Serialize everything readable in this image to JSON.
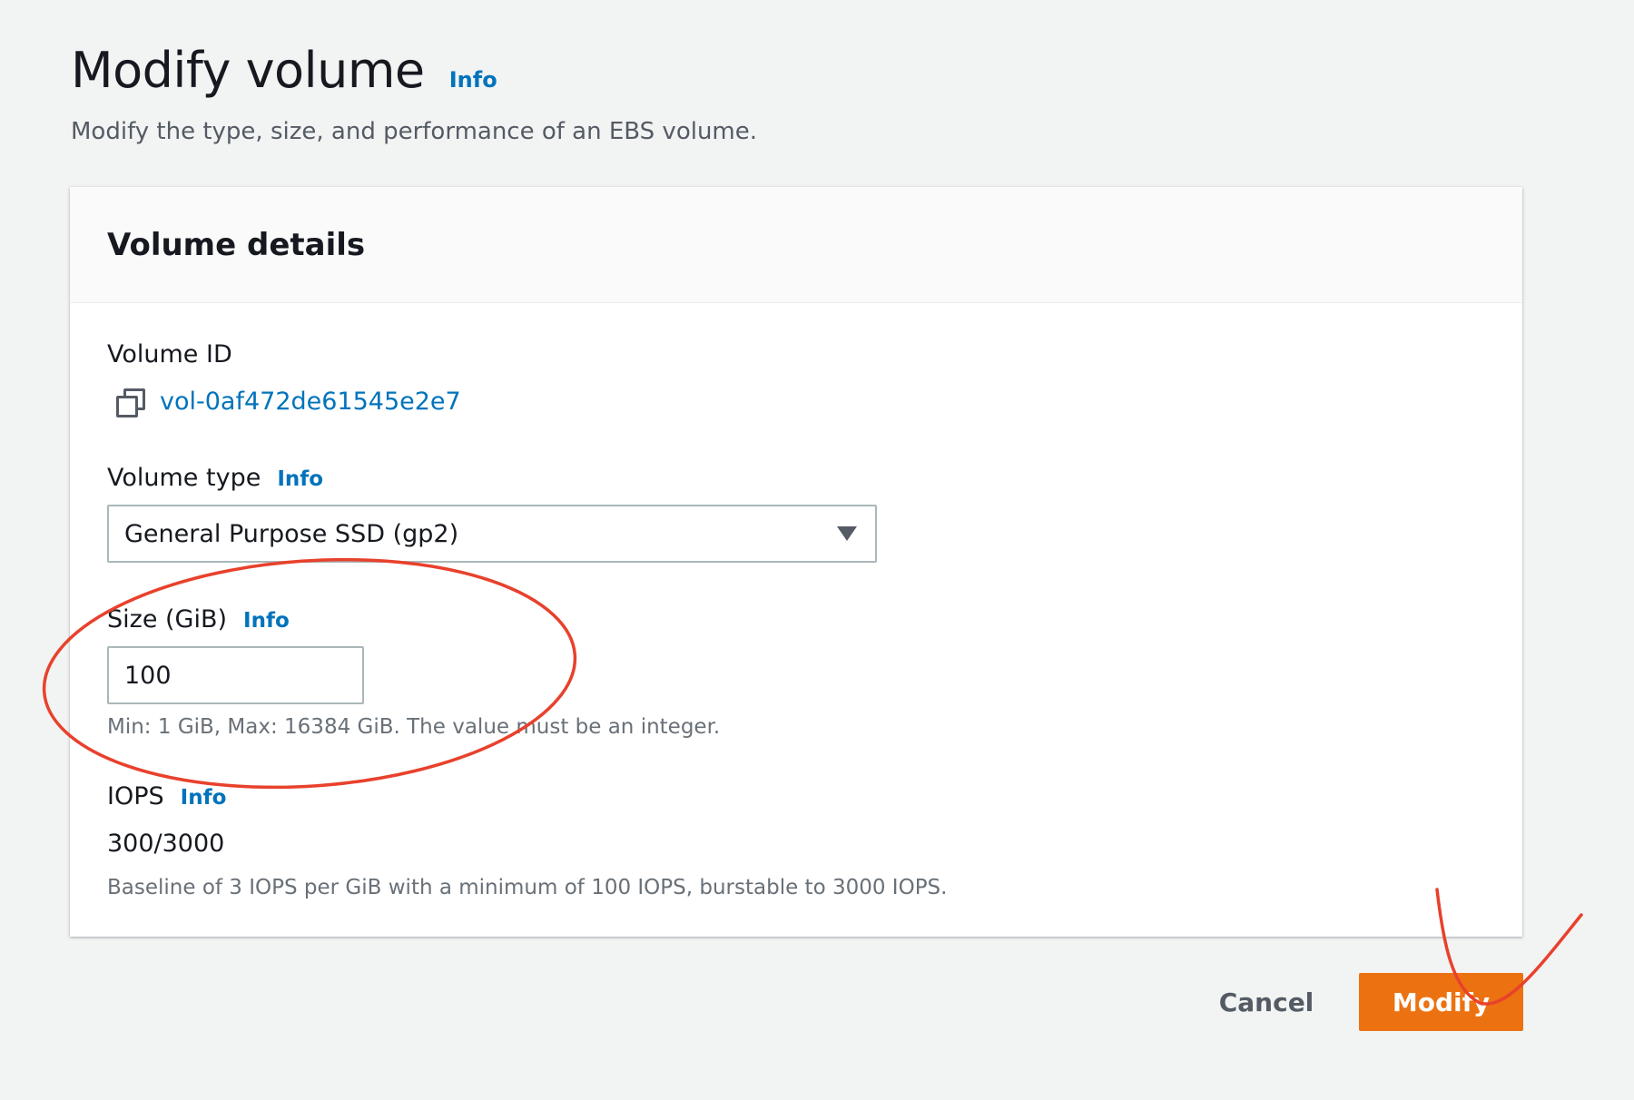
{
  "header": {
    "title": "Modify volume",
    "info_label": "Info",
    "subtitle": "Modify the type, size, and performance of an EBS volume."
  },
  "panel": {
    "title": "Volume details",
    "volume_id": {
      "label": "Volume ID",
      "value": "vol-0af472de61545e2e7",
      "icon": "copy-icon"
    },
    "volume_type": {
      "label": "Volume type",
      "info_label": "Info",
      "selected": "General Purpose SSD (gp2)"
    },
    "size": {
      "label": "Size (GiB)",
      "info_label": "Info",
      "value": "100",
      "hint": "Min: 1 GiB, Max: 16384 GiB. The value must be an integer."
    },
    "iops": {
      "label": "IOPS",
      "info_label": "Info",
      "value": "300/3000",
      "hint": "Baseline of 3 IOPS per GiB with a minimum of 100 IOPS, burstable to 3000 IOPS."
    }
  },
  "actions": {
    "cancel_label": "Cancel",
    "modify_label": "Modify"
  },
  "colors": {
    "link": "#0073bb",
    "primary_button": "#ec7211",
    "annotation": "#e8412c"
  }
}
